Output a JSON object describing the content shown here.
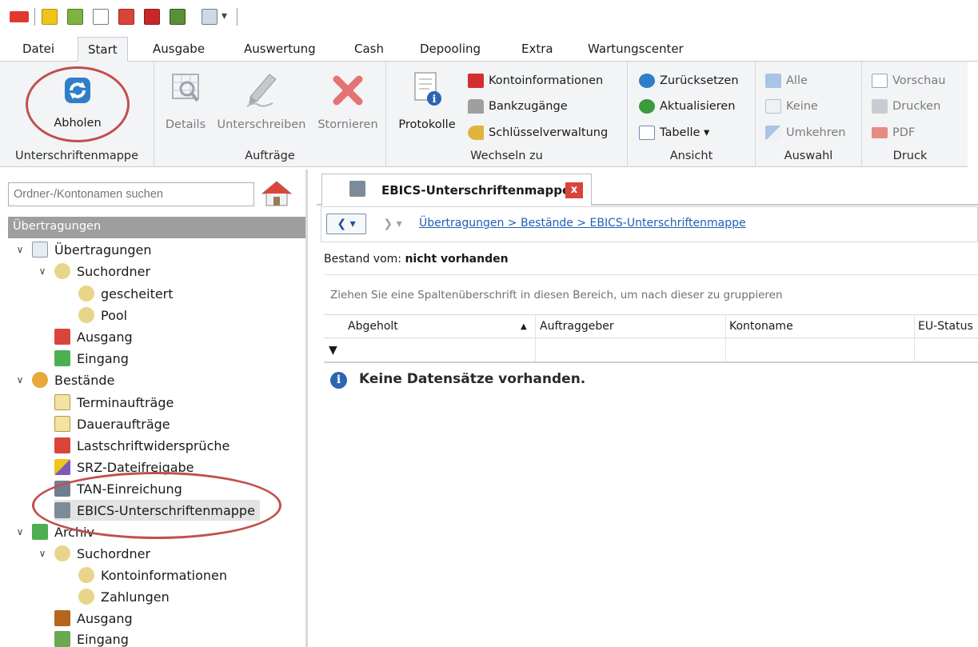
{
  "ribbon": {
    "tabs": [
      "Datei",
      "Start",
      "Ausgabe",
      "Auswertung",
      "Cash",
      "Depooling",
      "Extra",
      "Wartungscenter"
    ],
    "active_tab": "Start",
    "groups": {
      "unterschriftenmappe": {
        "label": "Unterschriftenmappe",
        "abholen": "Abholen"
      },
      "auftraege": {
        "label": "Aufträge",
        "details": "Details",
        "unterschreiben": "Unterschreiben",
        "stornieren": "Stornieren"
      },
      "wechseln": {
        "label": "Wechseln zu",
        "protokolle": "Protokolle",
        "kontoinformationen": "Kontoinformationen",
        "bankzugaenge": "Bankzugänge",
        "schluesselverwaltung": "Schlüsselverwaltung"
      },
      "ansicht": {
        "label": "Ansicht",
        "zuruecksetzen": "Zurücksetzen",
        "aktualisieren": "Aktualisieren",
        "tabelle": "Tabelle ▾"
      },
      "auswahl": {
        "label": "Auswahl",
        "alle": "Alle",
        "keine": "Keine",
        "umkehren": "Umkehren"
      },
      "druck": {
        "label": "Druck",
        "vorschau": "Vorschau",
        "drucken": "Drucken",
        "pdf": "PDF"
      }
    }
  },
  "sidebar": {
    "search_placeholder": "Ordner-/Kontonamen suchen",
    "header": "Übertragungen",
    "tree": {
      "uebertragungen": "Übertragungen",
      "suchordner": "Suchordner",
      "gescheitert": "gescheitert",
      "pool": "Pool",
      "ausgang": "Ausgang",
      "eingang": "Eingang",
      "bestaende": "Bestände",
      "terminauftraege": "Terminaufträge",
      "dauerauftraege": "Daueraufträge",
      "lastschriftwidersprueche": "Lastschriftwidersprüche",
      "srz_dateifreigabe": "SRZ-Dateifreigabe",
      "tan_einreichung": "TAN-Einreichung",
      "ebics_unterschriftenmappe": "EBICS-Unterschriftenmappe",
      "archiv": "Archiv",
      "archiv_suchordner": "Suchordner",
      "kontoinformationen": "Kontoinformationen",
      "zahlungen": "Zahlungen",
      "archiv_ausgang": "Ausgang",
      "archiv_eingang": "Eingang"
    }
  },
  "main": {
    "tab_title": "EBICS-Unterschriftenmappe",
    "tab_close": "x",
    "breadcrumb": "Übertragungen > Bestände > EBICS-Unterschriftenmappe",
    "bestand_label": "Bestand vom:",
    "bestand_value": "nicht vorhanden",
    "group_hint": "Ziehen Sie eine Spaltenüberschrift in diesen Bereich, um nach dieser zu gruppieren",
    "columns": [
      "Abgeholt",
      "Auftraggeber",
      "Kontoname",
      "EU-Status"
    ],
    "empty_message": "Keine Datensätze vorhanden.",
    "info_glyph": "i"
  },
  "colors": {
    "highlight_ellipse": "#c0504d",
    "link": "#1f5fb2",
    "ribbon_bg": "#f3f4f6"
  }
}
